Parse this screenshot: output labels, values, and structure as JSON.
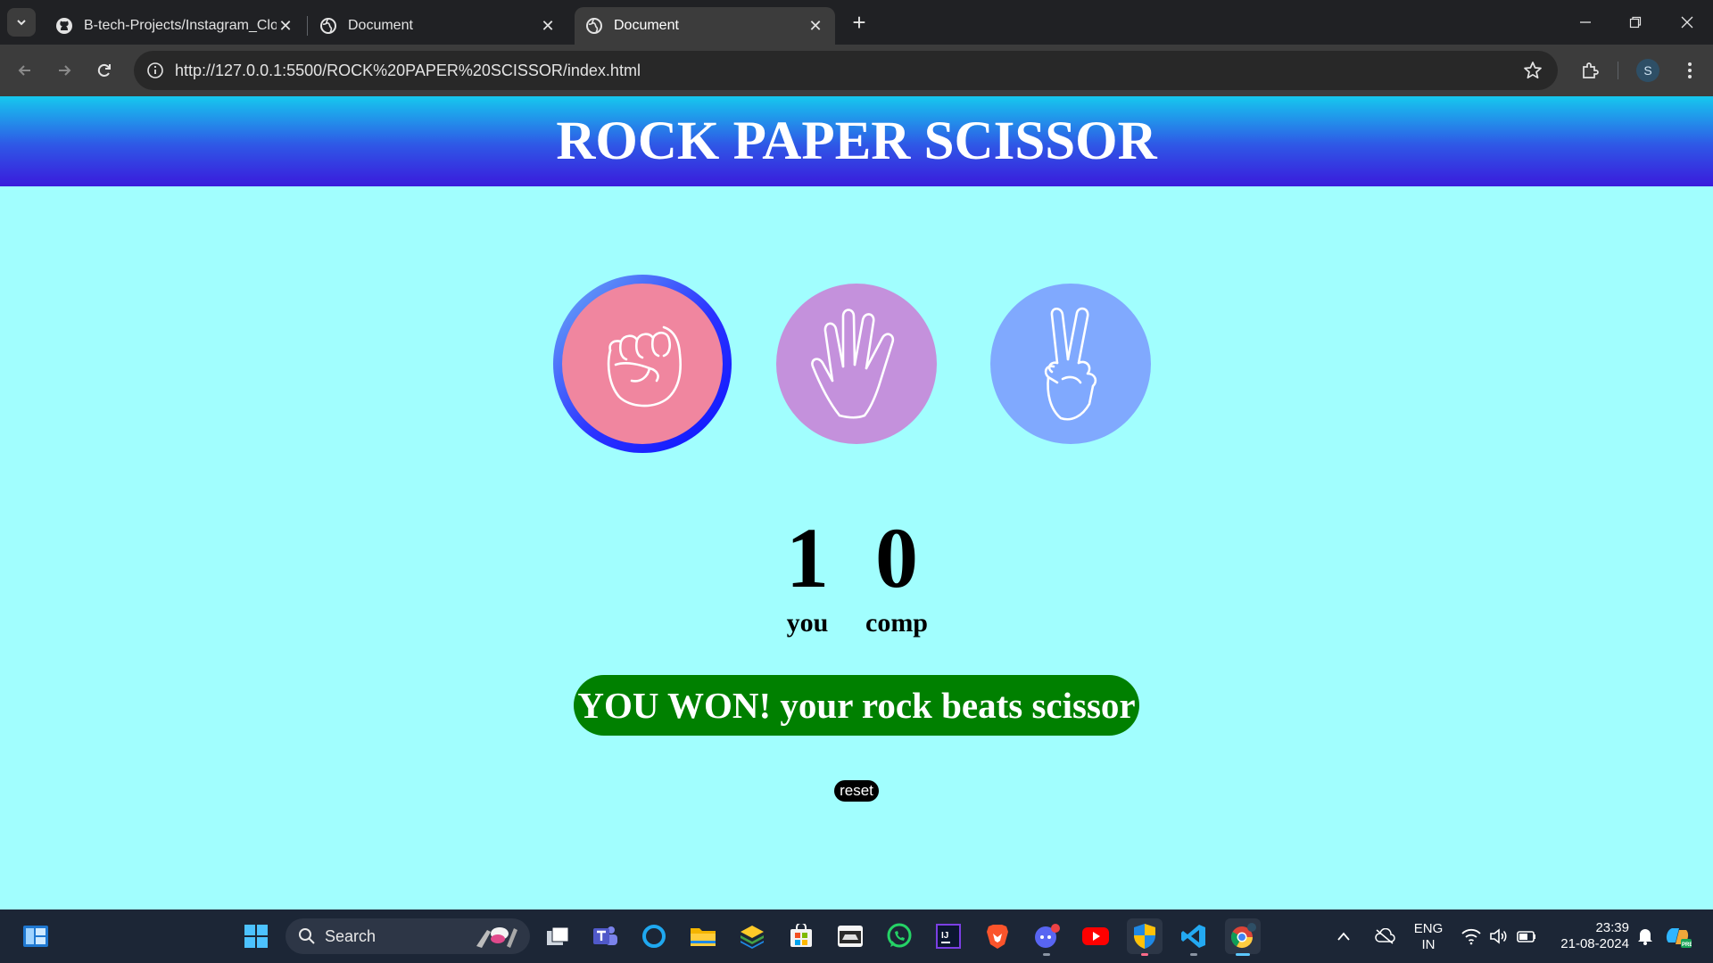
{
  "browser": {
    "tabs": [
      {
        "title": "B-tech-Projects/Instagram_Clon",
        "icon": "github-icon",
        "active": false
      },
      {
        "title": "Document",
        "icon": "globe-icon",
        "active": false
      },
      {
        "title": "Document",
        "icon": "globe-icon",
        "active": true
      }
    ],
    "url": "http://127.0.0.1:5500/ROCK%20PAPER%20SCISSOR/index.html",
    "profile_initial": "S"
  },
  "page": {
    "title": "ROCK PAPER SCISSOR",
    "choices": [
      {
        "name": "rock",
        "icon": "fist-icon",
        "color": "#f0869f",
        "selected": true
      },
      {
        "name": "paper",
        "icon": "open-hand-icon",
        "color": "#c491dc",
        "selected": false
      },
      {
        "name": "scissor",
        "icon": "victory-hand-icon",
        "color": "#80a9fe",
        "selected": false
      }
    ],
    "score": {
      "you": "1",
      "you_label": "you",
      "comp": "0",
      "comp_label": "comp"
    },
    "message": "YOU WON! your rock beats scissor",
    "message_color": "#008000",
    "reset_label": "reset"
  },
  "taskbar": {
    "search_label": "Search",
    "lang_line1": "ENG",
    "lang_line2": "IN",
    "time": "23:39",
    "date": "21-08-2024"
  }
}
